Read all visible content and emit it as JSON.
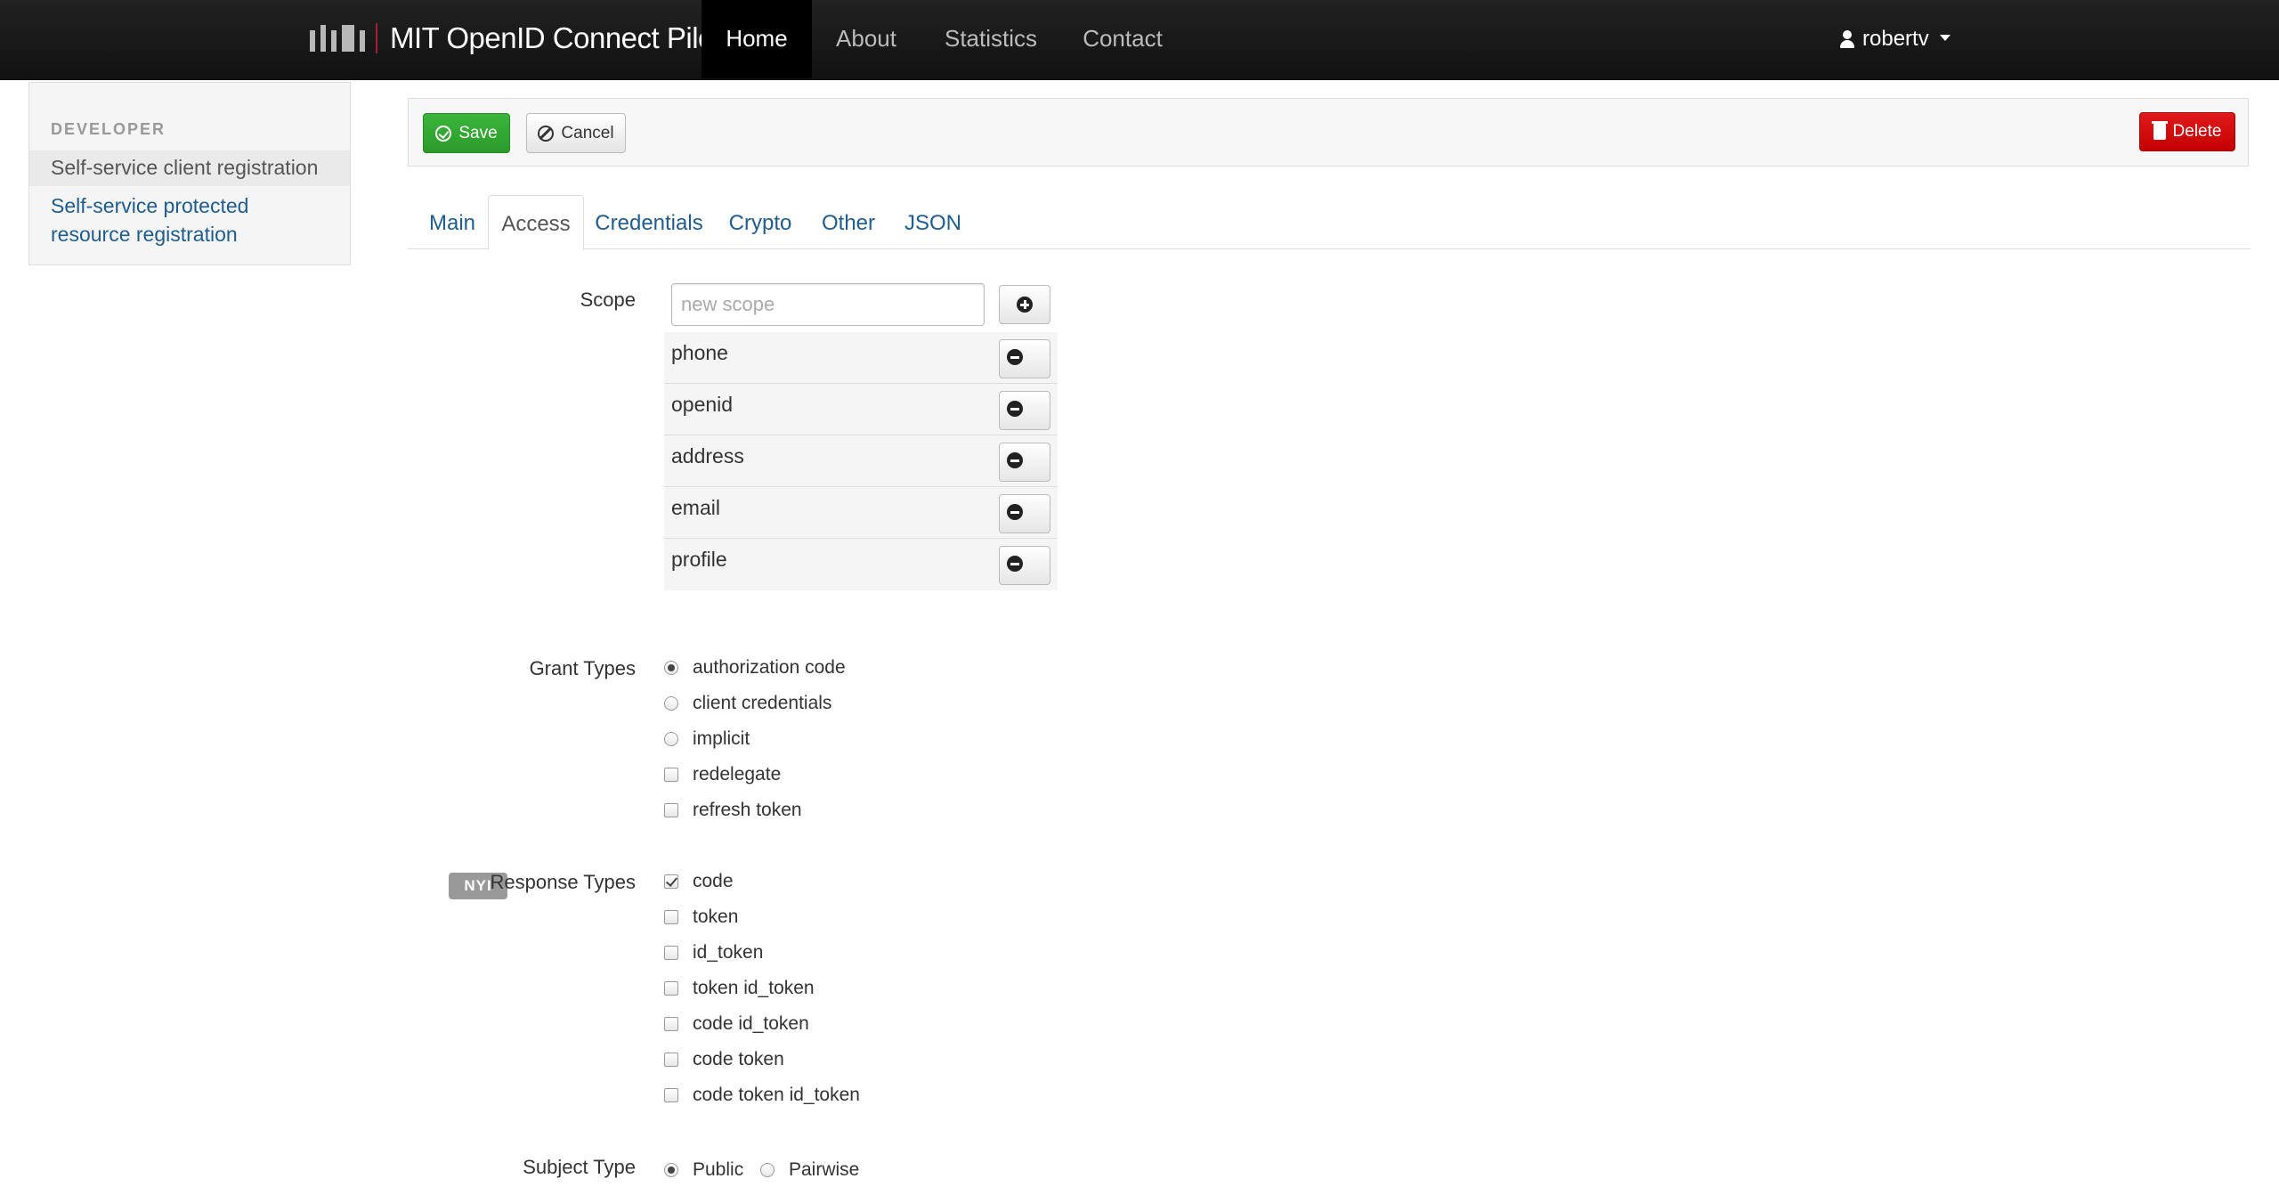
{
  "navbar": {
    "brand": "MIT OpenID Connect Pilot",
    "items": [
      {
        "label": "Home"
      },
      {
        "label": "About"
      },
      {
        "label": "Statistics"
      },
      {
        "label": "Contact"
      }
    ],
    "user": "robertv"
  },
  "sidebar": {
    "header": "DEVELOPER",
    "items": [
      {
        "label": "Self-service client registration"
      },
      {
        "label": "Self-service protected resource registration"
      }
    ]
  },
  "toolbar": {
    "save_label": "Save",
    "cancel_label": "Cancel",
    "delete_label": "Delete"
  },
  "tabs": [
    {
      "label": "Main"
    },
    {
      "label": "Access"
    },
    {
      "label": "Credentials"
    },
    {
      "label": "Crypto"
    },
    {
      "label": "Other"
    },
    {
      "label": "JSON"
    }
  ],
  "form": {
    "scope": {
      "label": "Scope",
      "placeholder": "new scope",
      "values": [
        "phone",
        "openid",
        "address",
        "email",
        "profile"
      ]
    },
    "grant_types": {
      "label": "Grant Types",
      "options": [
        {
          "label": "authorization code",
          "control": "radio",
          "checked": true
        },
        {
          "label": "client credentials",
          "control": "radio",
          "checked": false
        },
        {
          "label": "implicit",
          "control": "radio",
          "checked": false
        },
        {
          "label": "redelegate",
          "control": "checkbox",
          "checked": false
        },
        {
          "label": "refresh token",
          "control": "checkbox",
          "checked": false
        }
      ]
    },
    "response_types": {
      "label": "Response Types",
      "badge": "NYI",
      "options": [
        {
          "label": "code",
          "checked": true
        },
        {
          "label": "token",
          "checked": false
        },
        {
          "label": "id_token",
          "checked": false
        },
        {
          "label": "token id_token",
          "checked": false
        },
        {
          "label": "code id_token",
          "checked": false
        },
        {
          "label": "code token",
          "checked": false
        },
        {
          "label": "code token id_token",
          "checked": false
        }
      ]
    },
    "subject_type": {
      "label": "Subject Type",
      "options": [
        {
          "label": "Public",
          "checked": true
        },
        {
          "label": "Pairwise",
          "checked": false
        }
      ]
    }
  }
}
